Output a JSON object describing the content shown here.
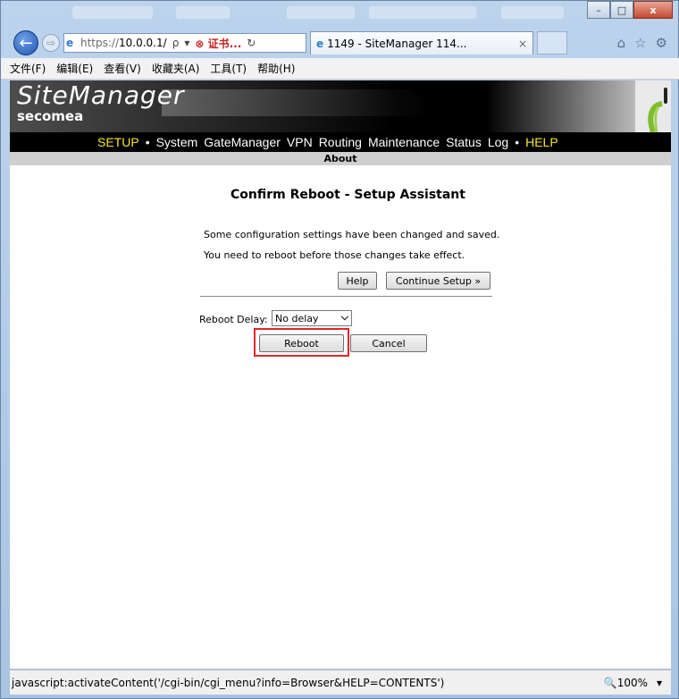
{
  "browser": {
    "address_scheme": "https://",
    "address_host": "10.0.0.1/",
    "search_glyph": "ρ",
    "dropdown_glyph": "▾",
    "cert_label": "证书...",
    "refresh_glyph": "↻",
    "tab_title": "1149 - SiteManager 114...",
    "tab_close": "×",
    "back_glyph": "←",
    "forward_glyph": "⇨",
    "home_glyph": "⌂",
    "star_glyph": "☆",
    "gear_glyph": "⚙",
    "win_min": "–",
    "win_max": "□",
    "win_close": "x"
  },
  "menu": {
    "items": [
      "文件(F)",
      "编辑(E)",
      "查看(V)",
      "收藏夹(A)",
      "工具(T)",
      "帮助(H)"
    ]
  },
  "brand": {
    "logo_top": "SiteManager",
    "logo_bottom": "secomea"
  },
  "nav": {
    "setup": "SETUP",
    "sep": "•",
    "system": "System",
    "gatemanager": "GateManager",
    "vpn": "VPN",
    "routing": "Routing",
    "maintenance": "Maintenance",
    "status": "Status",
    "log": "Log",
    "help": "HELP",
    "sub": "About"
  },
  "dialog": {
    "title": "Confirm Reboot - Setup Assistant",
    "message1": "Some configuration settings have been changed and saved.",
    "message2": "You need to reboot before those changes take effect.",
    "help_button": "Help",
    "continue_button": "Continue Setup »",
    "delay_label": "Reboot Delay:",
    "delay_value": "No delay",
    "reboot_button": "Reboot",
    "cancel_button": "Cancel"
  },
  "statusbar": {
    "text": "javascript:activateContent('/cgi-bin/cgi_menu?info=Browser&HELP=CONTENTS')",
    "zoom": "🔍100%",
    "zoom_chevron": "▾"
  },
  "colors": {
    "nav_highlight": "#f5e62e",
    "reboot_highlight": "#e0262b"
  }
}
